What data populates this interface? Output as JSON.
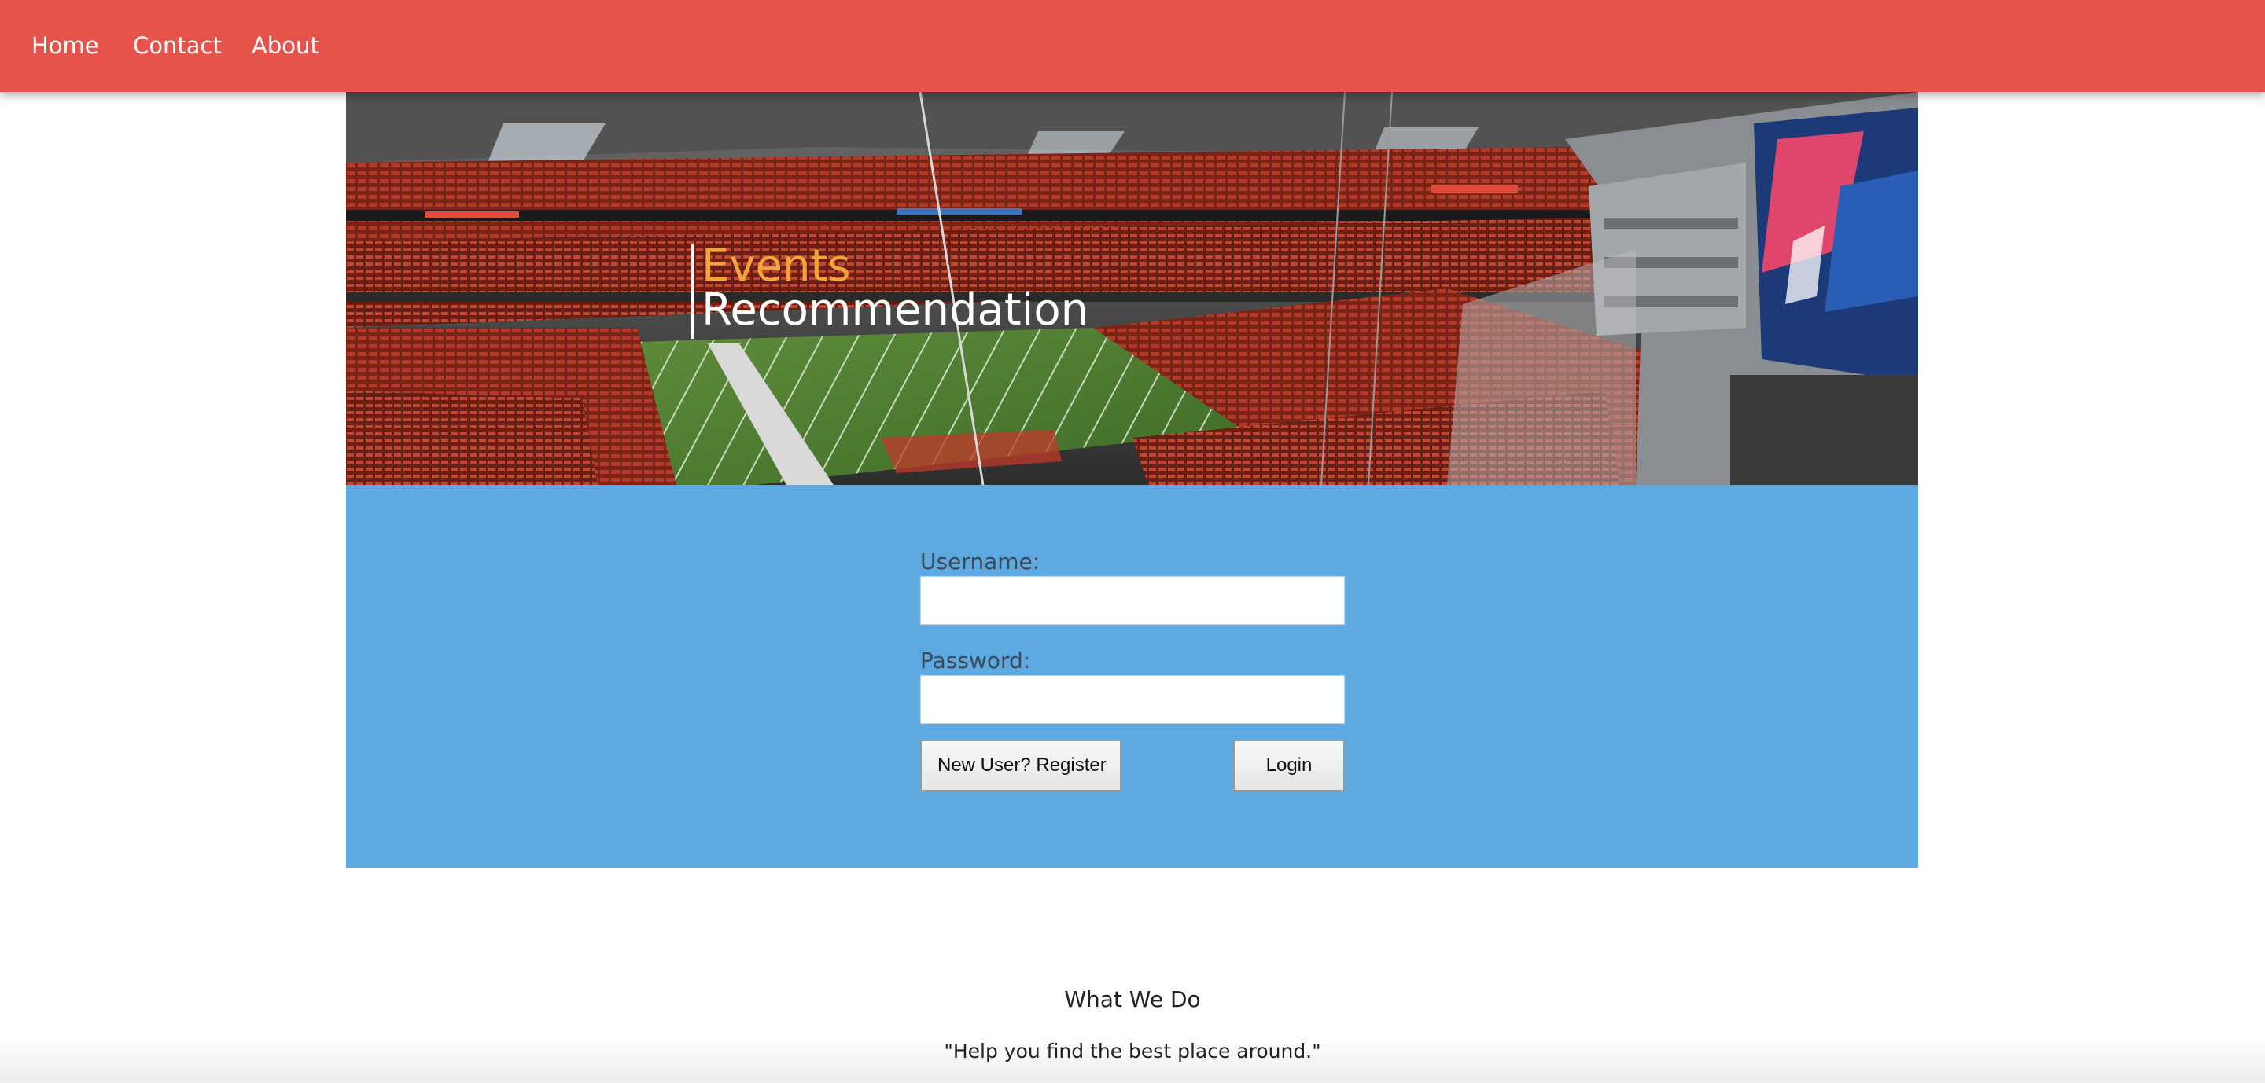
{
  "nav": {
    "items": [
      {
        "label": "Home"
      },
      {
        "label": "Contact"
      },
      {
        "label": "About"
      }
    ],
    "color": "#e5534b"
  },
  "hero": {
    "title_line1": "Events",
    "title_line2": "Recommendation",
    "title_line1_color": "#f5a43a",
    "title_line2_color": "#ffffff"
  },
  "login": {
    "username_label": "Username:",
    "username_value": "",
    "password_label": "Password:",
    "password_value": "",
    "register_button": "New User? Register",
    "login_button": "Login",
    "panel_color": "#5da9e1"
  },
  "about": {
    "heading": "What We Do",
    "tagline": "\"Help you find the best place around.\""
  }
}
